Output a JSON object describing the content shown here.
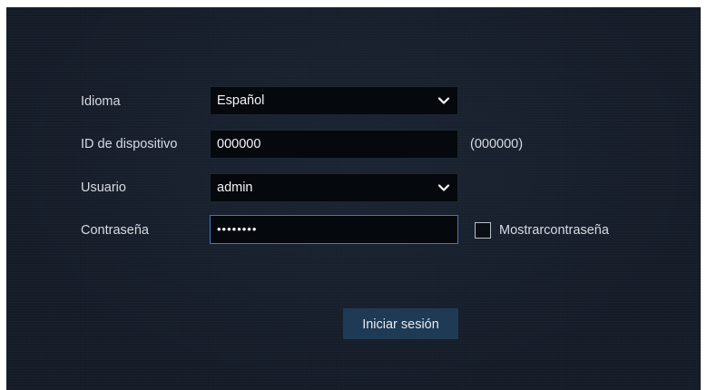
{
  "form": {
    "language": {
      "label": "Idioma",
      "value": "Español"
    },
    "device_id": {
      "label": "ID de dispositivo",
      "value": "000000",
      "hint": "(000000)"
    },
    "user": {
      "label": "Usuario",
      "value": "admin"
    },
    "password": {
      "label": "Contraseña",
      "value": "••••••••"
    },
    "show_password": {
      "label": "Mostrarcontraseña",
      "checked": false
    },
    "login_button": {
      "label": "Iniciar sesión"
    }
  },
  "icons": {
    "dropdown": "chevron-down-icon"
  },
  "colors": {
    "background": "#151d29",
    "field_background": "#05080c",
    "focus_border": "#3f78c0",
    "button_background": "#1f3a55",
    "text": "#d6dbe2"
  }
}
